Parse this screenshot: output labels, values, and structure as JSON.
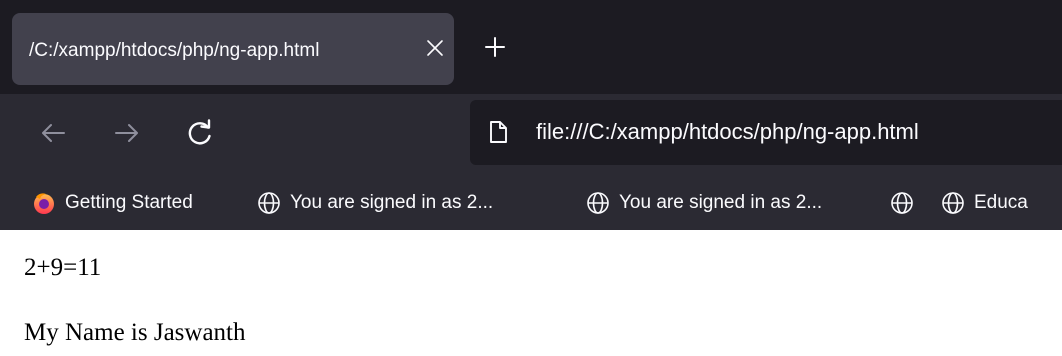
{
  "tab": {
    "title": "/C:/xampp/htdocs/php/ng-app.html",
    "close_icon": "close-icon",
    "new_tab_icon": "plus-icon"
  },
  "navigation": {
    "back_icon": "arrow-left-icon",
    "forward_icon": "arrow-right-icon",
    "reload_icon": "reload-icon"
  },
  "address_bar": {
    "icon": "page-icon",
    "url": "file:///C:/xampp/htdocs/php/ng-app.html"
  },
  "bookmarks": [
    {
      "label": "Getting Started",
      "icon": "firefox-icon"
    },
    {
      "label": "You are signed in as 2...",
      "icon": "globe-icon"
    },
    {
      "label": "You are signed in as 2...",
      "icon": "globe-icon"
    },
    {
      "label": "",
      "icon": "globe-icon"
    },
    {
      "label": "Educa",
      "icon": "globe-icon"
    }
  ],
  "page": {
    "lines": [
      "2+9=11",
      "My Name is Jaswanth"
    ]
  },
  "colors": {
    "tabbar_bg": "#1c1b22",
    "active_tab_bg": "#42414d",
    "toolbar_bg": "#2b2a33",
    "urlbar_bg": "#1c1b22",
    "chrome_text": "#fbfbfe",
    "page_bg": "#ffffff",
    "page_text": "#000000"
  }
}
